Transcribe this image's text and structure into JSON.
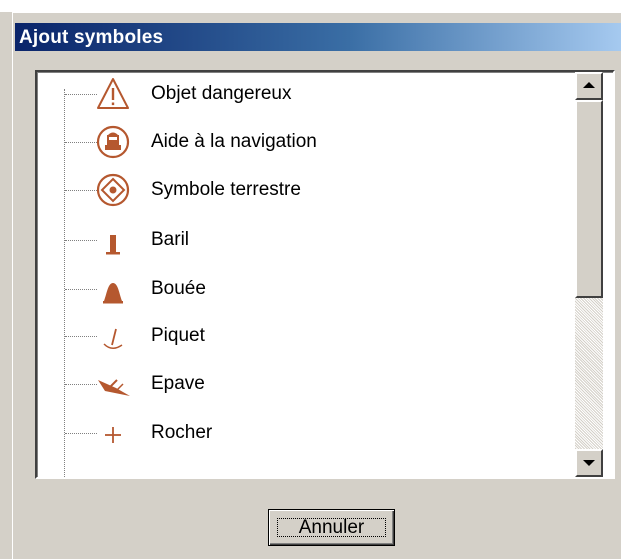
{
  "window": {
    "title": "Ajout symboles"
  },
  "symbols": [
    {
      "label": "Objet dangereux",
      "icon": "warning-triangle-icon"
    },
    {
      "label": "Aide à la navigation",
      "icon": "navigation-aid-icon"
    },
    {
      "label": "Symbole terrestre",
      "icon": "land-symbol-icon"
    },
    {
      "label": "Baril",
      "icon": "barrel-icon"
    },
    {
      "label": "Bouée",
      "icon": "buoy-icon"
    },
    {
      "label": "Piquet",
      "icon": "stake-icon"
    },
    {
      "label": "Epave",
      "icon": "wreck-icon"
    },
    {
      "label": "Rocher",
      "icon": "rock-cross-icon"
    }
  ],
  "buttons": {
    "cancel_label": "Annuler"
  },
  "colors": {
    "symbol": "#b5582f",
    "title_start": "#0a246a",
    "title_end": "#a6caf0"
  }
}
